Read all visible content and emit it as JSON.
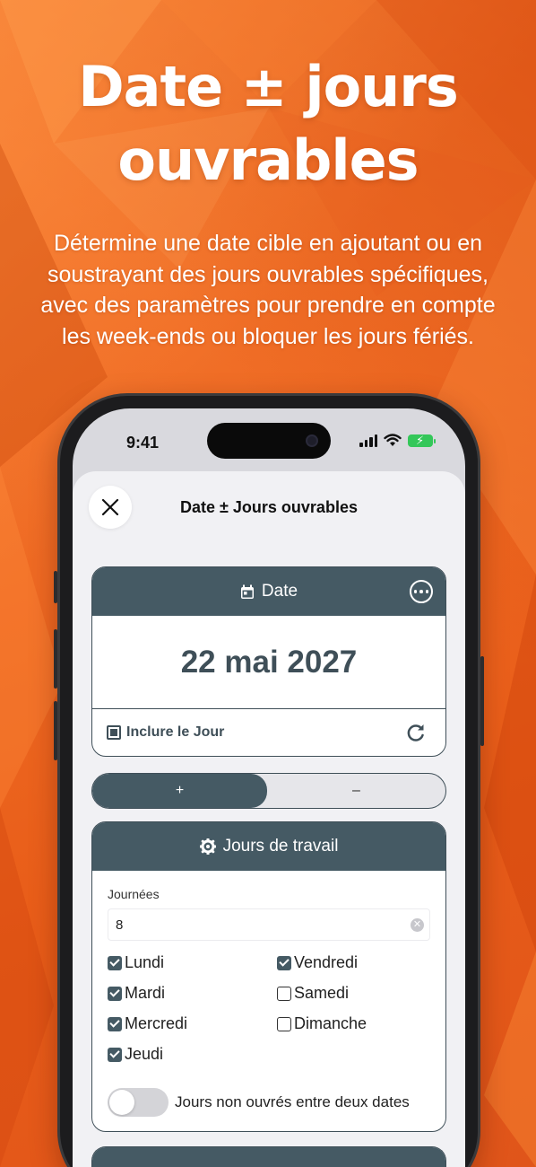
{
  "promo": {
    "title_line1": "Date ± jours",
    "title_line2": "ouvrables",
    "subtitle": "Détermine une date cible en ajoutant ou en soustrayant des jours ouvrables spécifiques, avec des paramètres pour prendre en compte les week-ends ou bloquer les jours fériés."
  },
  "status_bar": {
    "time": "9:41"
  },
  "sheet": {
    "title": "Date ± Jours ouvrables"
  },
  "date_card": {
    "header": "Date",
    "value": "22 mai 2027",
    "include_label": "Inclure le Jour"
  },
  "operation": {
    "plus_label": "+",
    "minus_label": "–",
    "selected": "+"
  },
  "workdays_card": {
    "header": "Jours de travail",
    "days_label": "Journées",
    "days_value": "8",
    "days": [
      {
        "label": "Lundi",
        "checked": true
      },
      {
        "label": "Mardi",
        "checked": true
      },
      {
        "label": "Mercredi",
        "checked": true
      },
      {
        "label": "Jeudi",
        "checked": true
      },
      {
        "label": "Vendredi",
        "checked": true
      },
      {
        "label": "Samedi",
        "checked": false
      },
      {
        "label": "Dimanche",
        "checked": false
      }
    ],
    "toggle_label": "Jours non ouvrés entre deux dates",
    "toggle_on": false
  },
  "colors": {
    "background": "#f06a22",
    "header": "#455a64",
    "text_dark": "#3f4f58",
    "battery": "#34c759"
  }
}
